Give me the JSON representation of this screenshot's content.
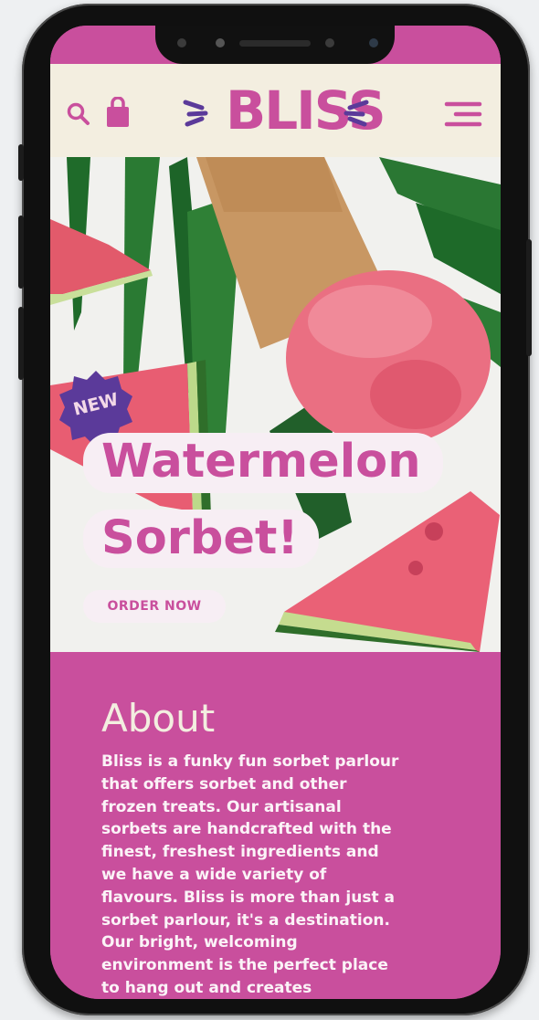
{
  "brand": {
    "logo_text": "BLISS",
    "accent": "#c94f9d",
    "cream": "#f3eee0",
    "badge": "#5b3a9a"
  },
  "header": {
    "icons": [
      "search-icon",
      "shopping-bag-icon",
      "hamburger-menu-icon"
    ]
  },
  "hero": {
    "badge": "NEW",
    "title_line1": "Watermelon",
    "title_line2": "Sorbet!",
    "cta": "ORDER NOW"
  },
  "about": {
    "heading": "About",
    "lines": [
      "Bliss is a funky fun sorbet parlour",
      "that offers sorbet and other",
      "frozen treats. Our artisanal",
      "sorbets are handcrafted with the",
      "finest, freshest ingredients and",
      "we have a wide variety of",
      "flavours. Bliss is more than just a",
      "sorbet parlour, it's a destination.",
      "Our bright, welcoming",
      "environment is the perfect place",
      "to hang out and creates"
    ]
  }
}
